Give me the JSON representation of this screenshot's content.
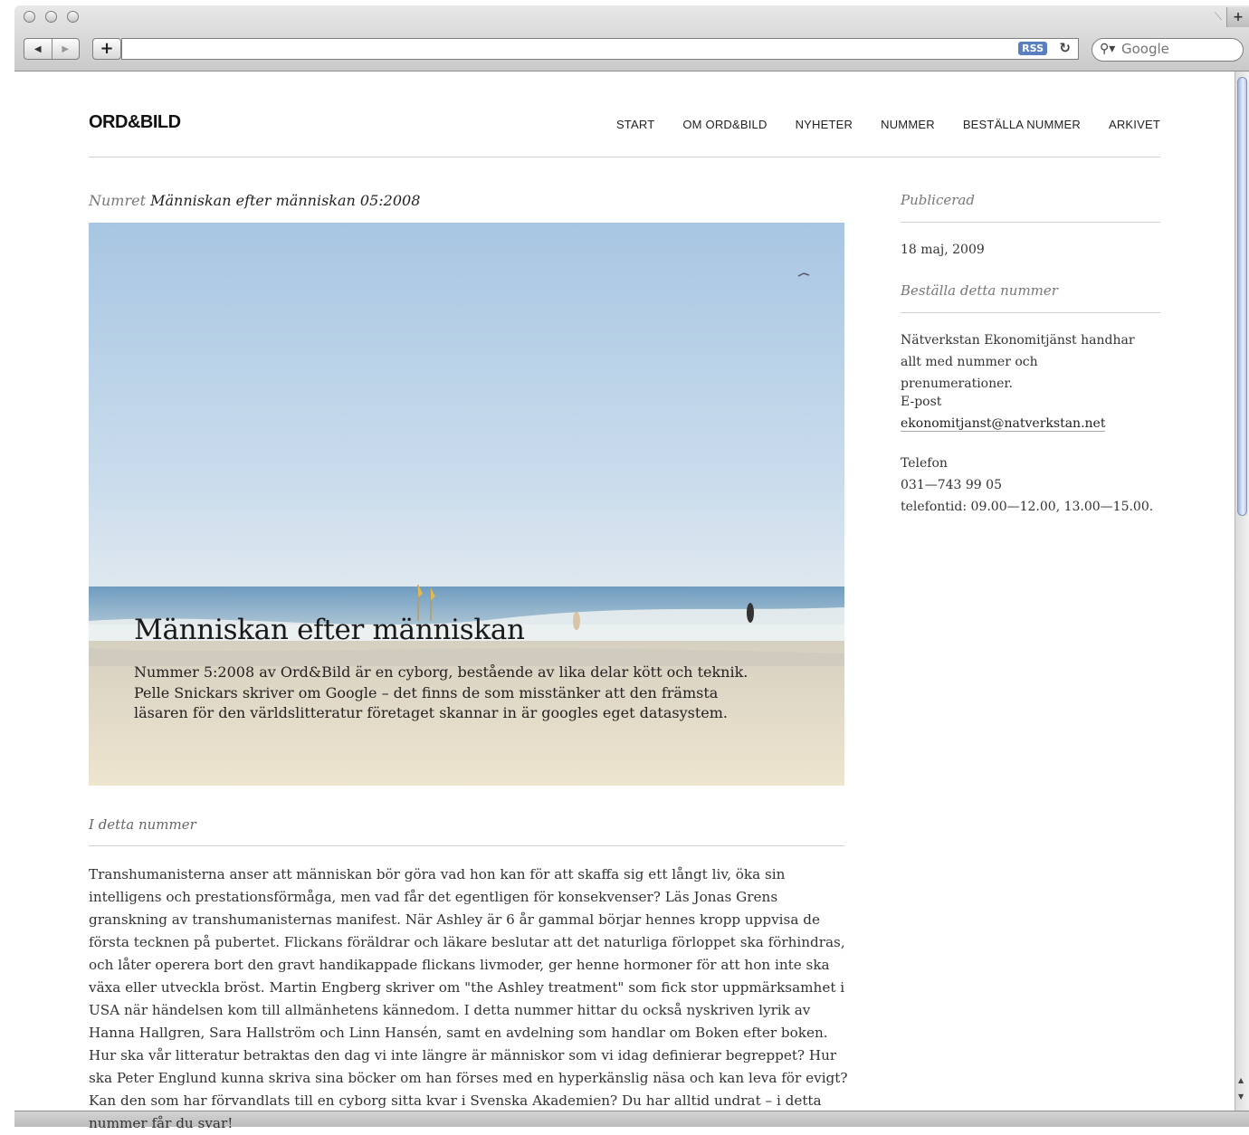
{
  "browser": {
    "back": "◀",
    "forward": "▶",
    "add": "+",
    "rss": "RSS",
    "reload": "↻",
    "search_placeholder": "Google",
    "new_tab": "+"
  },
  "site": {
    "logo": "ORD&BILD",
    "nav": [
      "START",
      "OM ORD&BILD",
      "NYHETER",
      "NUMMER",
      "BESTÄLLA NUMMER",
      "ARKIVET"
    ]
  },
  "issue": {
    "prefix": "Numret",
    "name": "Människan efter människan 05:2008"
  },
  "hero": {
    "title": "Människan efter människan",
    "description": "Nummer 5:2008 av Ord&Bild är en cyborg, bestående av lika delar kött och teknik. Pelle Snickars skriver om Google – det finns de som misstänker att den främsta läsaren för den världslitteratur företaget skannar in är googles eget datasystem."
  },
  "content": {
    "heading": "I detta nummer",
    "body": "Transhumanisterna anser att människan bör göra vad hon kan för att skaffa sig ett långt liv, öka sin intelligens och prestationsförmåga, men vad får det egentligen för konsekvenser? Läs Jonas Grens granskning av transhumanisternas manifest. När Ashley är 6 år gammal börjar hennes kropp uppvisa de första tecknen på pubertet. Flickans föräldrar och läkare beslutar att det naturliga förloppet ska förhindras, och låter operera bort den gravt handikappade flickans livmoder, ger henne hormoner för att hon inte ska växa eller utveckla bröst. Martin Engberg skriver om \"the Ashley treatment\" som fick stor uppmärksamhet i USA när händelsen kom till allmänhetens kännedom. I detta nummer hittar du också nyskriven lyrik av Hanna Hallgren, Sara Hallström och Linn Hansén, samt en avdelning som handlar om Boken efter boken. Hur ska vår litteratur betraktas den dag vi inte längre är människor som vi idag definierar begreppet? Hur ska Peter Englund kunna skriva sina böcker om han förses med en hyperkänslig näsa och kan leva för evigt? Kan den som har förvandlats till en cyborg sitta kvar i Svenska Akademien? Du har alltid undrat – i detta nummer får du svar!"
  },
  "sidebar": {
    "published_heading": "Publicerad",
    "published_date": "18 maj, 2009",
    "order_heading": "Beställa detta nummer",
    "order_text": "Nätverkstan Ekonomitjänst handhar allt med nummer och prenumerationer.",
    "email_label": "E-post",
    "email": "ekonomitjanst@natverkstan.net",
    "phone_label": "Telefon",
    "phone": "031—743 99 05",
    "phone_hours": "telefontid: 09.00—12.00, 13.00—15.00."
  }
}
